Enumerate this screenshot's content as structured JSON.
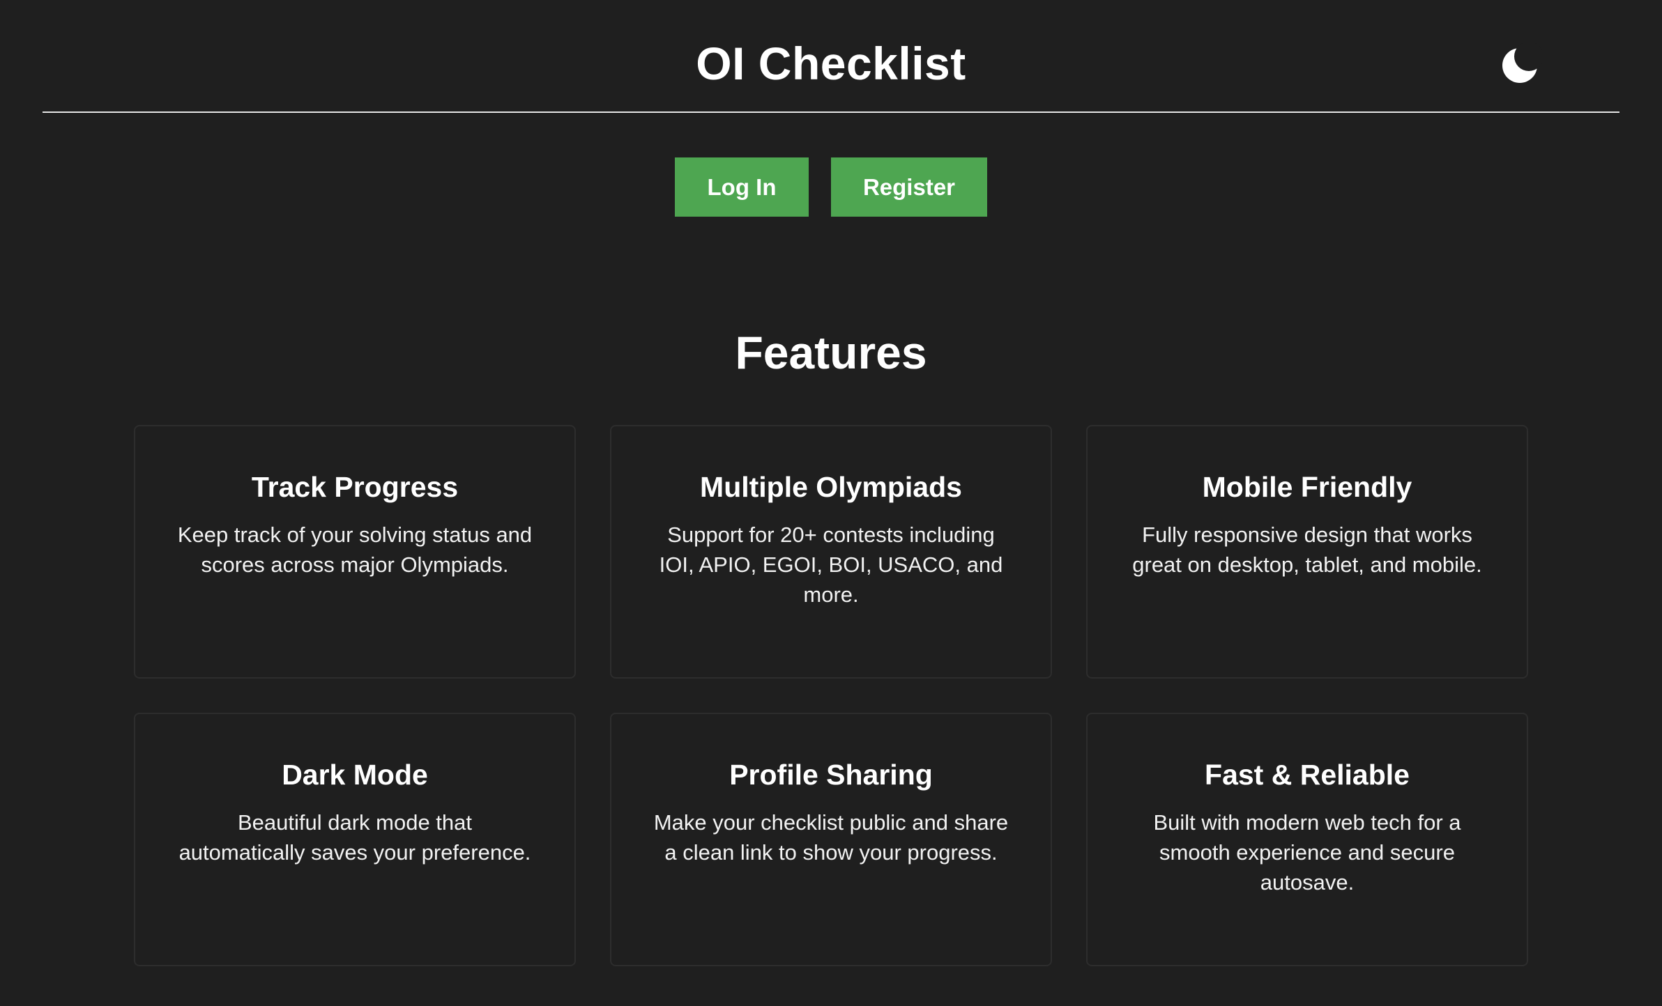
{
  "header": {
    "title": "OI Checklist",
    "theme_toggle_icon": "moon-icon"
  },
  "auth": {
    "login_label": "Log In",
    "register_label": "Register"
  },
  "features": {
    "heading": "Features",
    "items": [
      {
        "title": "Track Progress",
        "description": "Keep track of your solving status and scores across major Olympiads."
      },
      {
        "title": "Multiple Olympiads",
        "description": "Support for 20+ contests including IOI, APIO, EGOI, BOI, USACO, and more."
      },
      {
        "title": "Mobile Friendly",
        "description": "Fully responsive design that works great on desktop, tablet, and mobile."
      },
      {
        "title": "Dark Mode",
        "description": "Beautiful dark mode that automatically saves your preference."
      },
      {
        "title": "Profile Sharing",
        "description": "Make your checklist public and share a clean link to show your progress."
      },
      {
        "title": "Fast & Reliable",
        "description": "Built with modern web tech for a smooth experience and secure autosave."
      }
    ]
  },
  "colors": {
    "background": "#1f1f1f",
    "accent": "#4ea651",
    "text": "#ffffff",
    "card_border": "#2d2d2d"
  }
}
